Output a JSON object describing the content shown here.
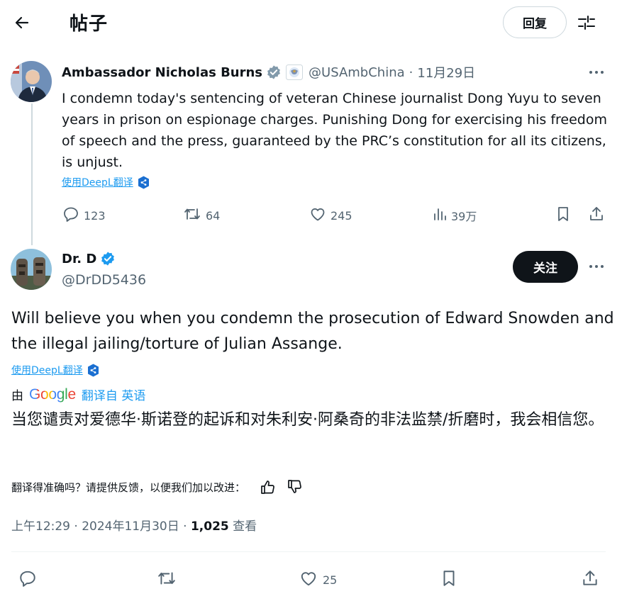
{
  "header": {
    "title": "帖子",
    "reply_label": "回复"
  },
  "tweet1": {
    "name": "Ambassador Nicholas Burns",
    "handle": "@USAmbChina",
    "date": "11月29日",
    "text": "I condemn today's sentencing of veteran Chinese journalist Dong Yuyu to seven years in prison on espionage charges.  Punishing Dong for exercising his freedom of speech and the press, guaranteed by the PRC’s constitution for all its citizens, is unjust.",
    "deepl_label": "使用DeepL翻译",
    "stats": {
      "replies": "123",
      "retweets": "64",
      "likes": "245",
      "views": "39万"
    }
  },
  "tweet2": {
    "name": "Dr. D",
    "handle": "@DrDD5436",
    "follow_label": "关注",
    "text": "Will believe you when you condemn the prosecution of Edward Snowden and the illegal jailing/torture of Julian Assange.",
    "deepl_label": "使用DeepL翻译",
    "translated_by_prefix": "由",
    "translated_by_brand": "Google",
    "translated_from": "翻译自 英语",
    "translated_text": "当您谴责对爱德华·斯诺登的起诉和对朱利安·阿桑奇的非法监禁/折磨时，我会相信您。",
    "feedback_prompt": "翻译得准确吗？请提供反馈，以便我们加以改进：",
    "time": "上午12:29 · 2024年11月30日 · ",
    "views_count": "1,025",
    "views_label": " 查看",
    "likes": "25"
  },
  "colors": {
    "accent": "#1d9bf0",
    "text": "#0f1419",
    "muted": "#536471",
    "border": "#cfd9de"
  }
}
